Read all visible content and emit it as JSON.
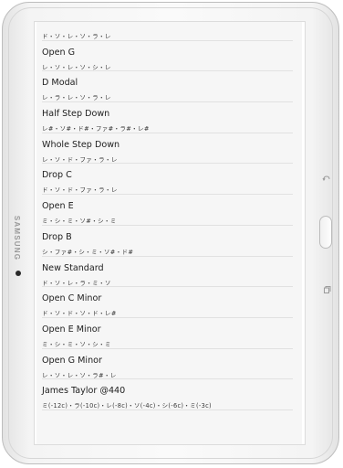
{
  "device": {
    "brand": "SAMSUNG"
  },
  "tunings": [
    {
      "title": "",
      "notes": "ド・ソ・レ・ソ・ラ・レ"
    },
    {
      "title": "Open G",
      "notes": "レ・ソ・レ・ソ・シ・レ"
    },
    {
      "title": "D Modal",
      "notes": "レ・ラ・レ・ソ・ラ・レ"
    },
    {
      "title": "Half Step Down",
      "notes": "レ#・ソ#・ド#・ファ#・ラ#・レ#"
    },
    {
      "title": "Whole Step Down",
      "notes": "レ・ソ・ド・ファ・ラ・レ"
    },
    {
      "title": "Drop C",
      "notes": "ド・ソ・ド・ファ・ラ・レ"
    },
    {
      "title": "Open E",
      "notes": "ミ・シ・ミ・ソ#・シ・ミ"
    },
    {
      "title": "Drop B",
      "notes": "シ・ファ#・シ・ミ・ソ#・ド#"
    },
    {
      "title": "New Standard",
      "notes": "ド・ソ・レ・ラ・ミ・ソ"
    },
    {
      "title": "Open C Minor",
      "notes": "ド・ソ・ド・ソ・ド・レ#"
    },
    {
      "title": "Open E Minor",
      "notes": "ミ・シ・ミ・ソ・シ・ミ"
    },
    {
      "title": "Open G Minor",
      "notes": "レ・ソ・レ・ソ・ラ#・レ"
    },
    {
      "title": "James Taylor @440",
      "notes": "ミ(-12c)・ラ(-10c)・レ(-8c)・ソ(-4c)・シ(-6c)・ミ(-3c)"
    }
  ]
}
